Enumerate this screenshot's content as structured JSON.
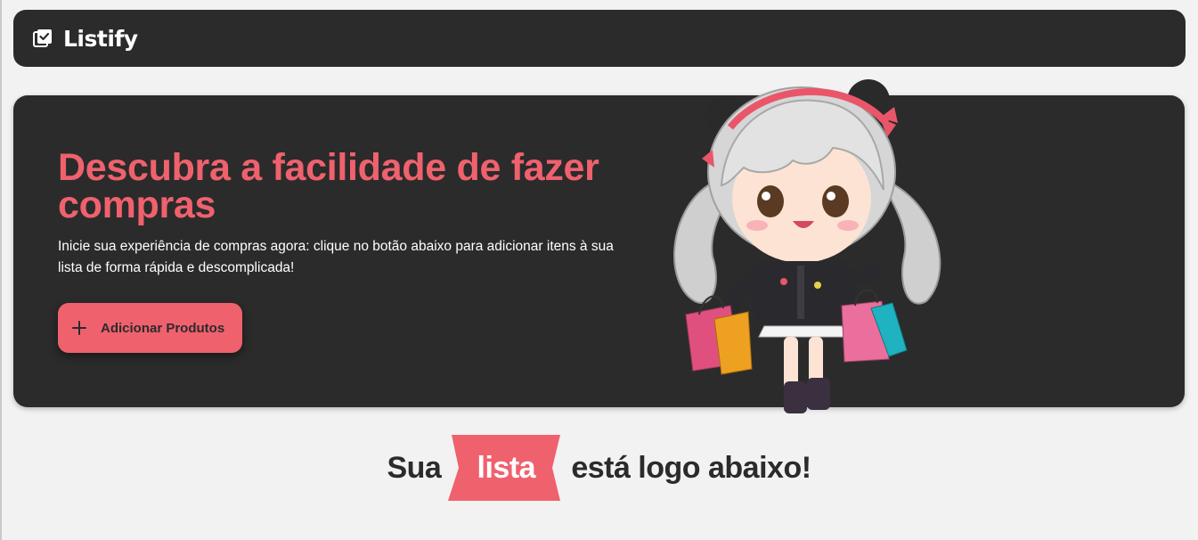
{
  "navbar": {
    "brand_icon": "checklist-icon",
    "brand_name": "Listify"
  },
  "hero": {
    "title": "Descubra a facilidade de fazer compras",
    "description": "Inicie sua experiência de compras agora: clique no botão abaixo para adicionar itens à sua lista de forma rápida e descomplicada!",
    "button_icon": "plus-icon",
    "button_label": "Adicionar Produtos",
    "illustration": "chibi-girl-with-shopping-bags"
  },
  "list_heading": {
    "before": "Sua",
    "highlight": "lista",
    "after": "está logo abaixo!"
  },
  "colors": {
    "accent": "#f0616e",
    "dark": "#2b2b2b",
    "background": "#f2f2f2",
    "text_light": "#ffffff"
  }
}
